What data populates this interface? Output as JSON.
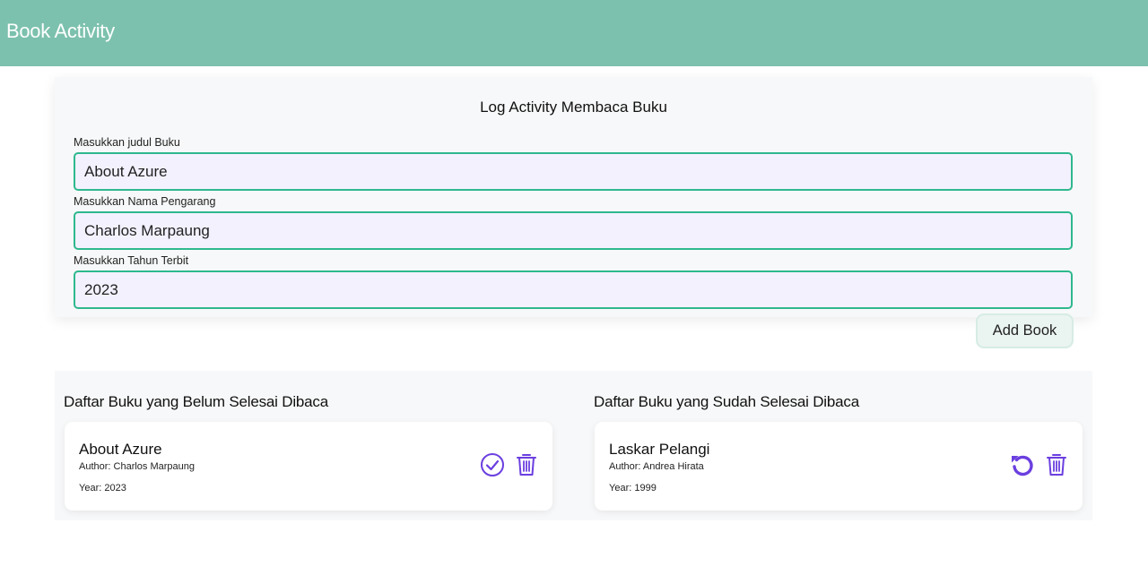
{
  "header": {
    "title": "Book Activity"
  },
  "form": {
    "title": "Log Activity Membaca Buku",
    "fields": [
      {
        "label": "Masukkan judul Buku",
        "value": "About Azure"
      },
      {
        "label": "Masukkan Nama Pengarang",
        "value": "Charlos Marpaung"
      },
      {
        "label": "Masukkan Tahun Terbit",
        "value": "2023"
      }
    ],
    "submit_label": "Add Book"
  },
  "unfinished": {
    "heading": "Daftar Buku yang Belum Selesai Dibaca",
    "books": [
      {
        "title": "About Azure",
        "author": "Author: Charlos Marpaung",
        "year": "Year: 2023",
        "icons": [
          "check-circle-icon",
          "trash-icon"
        ]
      }
    ]
  },
  "finished": {
    "heading": "Daftar Buku yang Sudah Selesai Dibaca",
    "books": [
      {
        "title": "Laskar Pelangi",
        "author": "Author: Andrea Hirata",
        "year": "Year: 1999",
        "icons": [
          "undo-icon",
          "trash-icon"
        ]
      }
    ]
  },
  "colors": {
    "header_bg": "#7cc1ad",
    "input_border": "#2eb88d",
    "input_bg": "#f4f1ff",
    "icon_purple": "#6b3fe0"
  }
}
